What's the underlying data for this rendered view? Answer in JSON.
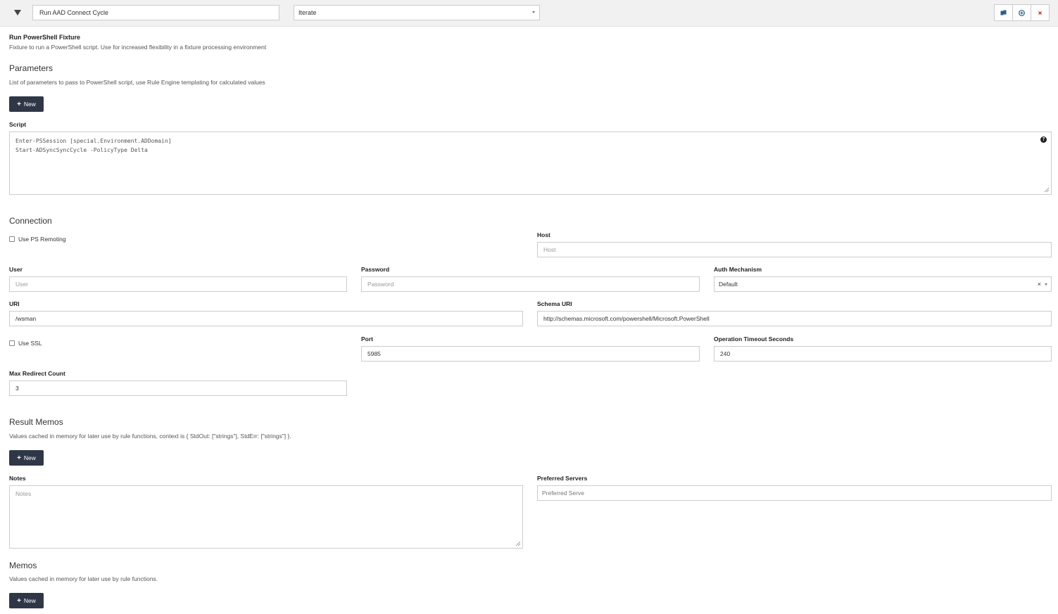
{
  "header": {
    "fixture_name": "Run AAD Connect Cycle",
    "mode": "Iterate",
    "actions": [
      {
        "icon": "copy-icon"
      },
      {
        "icon": "add-circle-icon"
      },
      {
        "icon": "close-icon"
      }
    ]
  },
  "fixture": {
    "title": "Run PowerShell Fixture",
    "description": "Fixture to run a PowerShell script. Use for increased flexibility in a fixture processing environment"
  },
  "parameters": {
    "title": "Parameters",
    "help": "List of parameters to pass to PowerShell script, use Rule Engine templating for calculated values",
    "new_label": "New"
  },
  "script": {
    "label": "Script",
    "lines": [
      "Enter-PSSession [special.Environment.ADDomain]",
      "Start-ADSyncSyncCycle -PolicyType Delta"
    ]
  },
  "connection": {
    "title": "Connection",
    "use_ps_remoting": "Use PS Remoting",
    "host_label": "Host",
    "host_placeholder": "Host",
    "user_label": "User",
    "user_placeholder": "User",
    "password_label": "Password",
    "password_placeholder": "Password",
    "auth_label": "Auth Mechanism",
    "auth_value": "Default",
    "uri_label": "URI",
    "uri_value": "/wsman",
    "schema_uri_label": "Schema URI",
    "schema_uri_value": "http://schemas.microsoft.com/powershell/Microsoft.PowerShell",
    "use_ssl": "Use SSL",
    "port_label": "Port",
    "port_value": "5985",
    "timeout_label": "Operation Timeout Seconds",
    "timeout_value": "240",
    "max_redirect_label": "Max Redirect Count",
    "max_redirect_value": "3"
  },
  "result_memos": {
    "title": "Result Memos",
    "help": "Values cached in memory for later use by rule functions, context is { StdOut: [\"strings\"], StdErr: [\"strings\"] }.",
    "new_label": "New"
  },
  "notes": {
    "label": "Notes",
    "placeholder": "Notes"
  },
  "preferred_servers": {
    "label": "Preferred Servers",
    "placeholder": "Preferred Serve"
  },
  "memos": {
    "title": "Memos",
    "help": "Values cached in memory for later use by rule functions.",
    "new_label": "New"
  }
}
